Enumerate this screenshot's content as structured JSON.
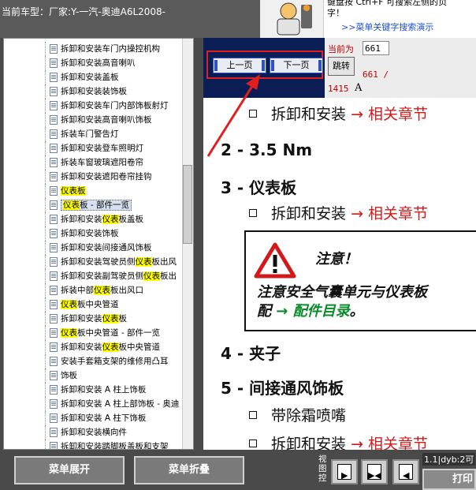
{
  "header": {
    "car_model": "当前车型：厂家:Y-一汽-奥迪A6L2008-",
    "help_line1": "键盘按   Ctrl+F   可搜索左侧的页",
    "help_line2": "字！",
    "help_link": ">>菜单关键字搜索演示"
  },
  "tree": {
    "items": [
      {
        "label": "拆卸和安装车门内操控机构",
        "hl": ""
      },
      {
        "label": "拆卸和安装高音喇叭",
        "hl": ""
      },
      {
        "label": "拆卸和安装盖板",
        "hl": ""
      },
      {
        "label": "拆卸和安装装饰板",
        "hl": ""
      },
      {
        "label": "拆卸和安装车门内部饰板射灯",
        "hl": ""
      },
      {
        "label": "拆卸和安装高音喇叭饰板",
        "hl": ""
      },
      {
        "label": "拆装车门警告灯",
        "hl": ""
      },
      {
        "label": "拆卸和安装登车照明灯",
        "hl": ""
      },
      {
        "label": "拆装车窗玻璃遮阳卷帘",
        "hl": ""
      },
      {
        "label": "拆卸和安装遮阳卷帘挂钩",
        "hl": ""
      },
      {
        "label": "仪表板",
        "hl": "all"
      },
      {
        "label": "仪表板 - 部件一览",
        "hl": "selected"
      },
      {
        "label": "拆卸和安装仪表板盖板",
        "hl": ""
      },
      {
        "label": "拆卸和安装饰板",
        "hl": ""
      },
      {
        "label": "拆卸和安装间接通风饰板",
        "hl": ""
      },
      {
        "label": "拆卸和安装驾驶员侧仪表板出风",
        "hl": ""
      },
      {
        "label": "拆卸和安装副驾驶员侧仪表板出",
        "hl": ""
      },
      {
        "label": "拆装中部仪表板出风口",
        "hl": ""
      },
      {
        "label": "仪表板中央管道",
        "hl": ""
      },
      {
        "label": "拆卸和安装仪表板",
        "hl": ""
      },
      {
        "label": "仪表板中央管道 - 部件一览",
        "hl": ""
      },
      {
        "label": "拆卸和安装仪表板中央管道",
        "hl": ""
      },
      {
        "label": "安装手套箱支架的维修用凸耳",
        "hl": ""
      },
      {
        "label": "饰板",
        "hl": ""
      },
      {
        "label": "拆卸和安装 A 柱上饰板",
        "hl": ""
      },
      {
        "label": "拆卸和安装 A 柱上部饰板 - 奥迪",
        "hl": ""
      },
      {
        "label": "拆卸和安装 A 柱下饰板",
        "hl": ""
      },
      {
        "label": "拆卸和安装横向件",
        "hl": ""
      },
      {
        "label": "拆卸和安装踏脚板盖板和支架",
        "hl": ""
      }
    ]
  },
  "nav": {
    "prev": "上一页",
    "next": "下一页",
    "current_label": "当前为",
    "page_value": "661",
    "jump": "跳转",
    "page_frac": "661 /",
    "page_total": "1415",
    "page_suffix": "A"
  },
  "doc": {
    "line1_text": "拆卸和安装",
    "line1_ref": "→ 相关章节",
    "h2": "2 - 3.5 Nm",
    "h3": "3 - 仪表板",
    "line2_text": "拆卸和安装",
    "line2_ref": "→ 相关章节",
    "warn_title": "注意！",
    "warn_text1": "注意安全气囊单元与仪表板",
    "warn_text2_a": "配",
    "warn_text2_link": "→ 配件目录",
    "warn_text2_b": "。",
    "h4": "4 - 夹子",
    "h5": "5 - 间接通风饰板",
    "line3_text": "带除霜喷嘴",
    "line4_text": "拆卸和安装",
    "line4_ref": "→ 相关章节"
  },
  "bottom": {
    "expand": "菜单展开",
    "collapse": "菜单折叠",
    "view_label": "视图控",
    "status": "1.1|dyb:2可",
    "print": "打印"
  },
  "colors": {
    "accent_red": "#d11a1a",
    "nav_blue": "#0a1e55",
    "highlight": "#ffff00",
    "green": "#0a8a2a"
  }
}
